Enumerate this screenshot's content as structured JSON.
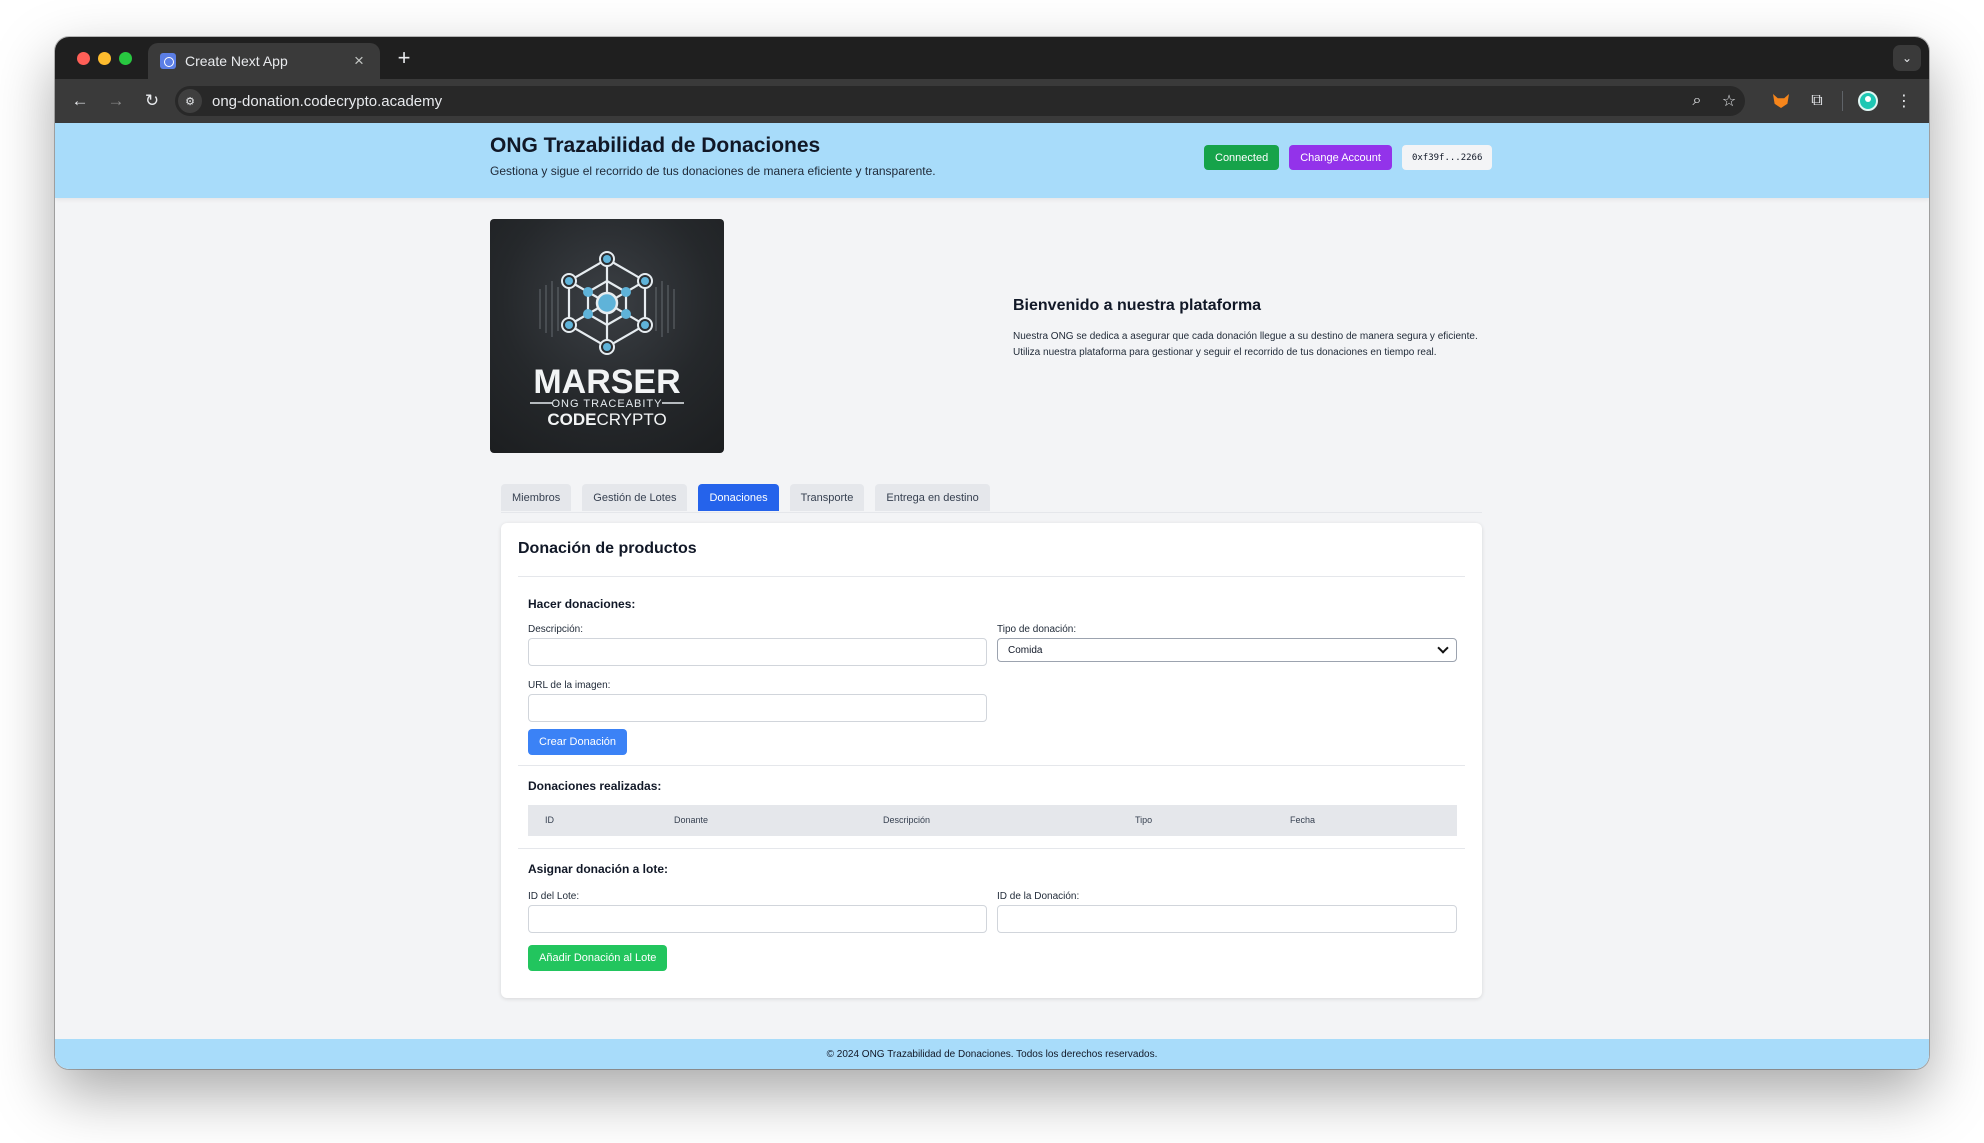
{
  "browser": {
    "tab_title": "Create Next App",
    "url": "ong-donation.codecrypto.academy"
  },
  "header": {
    "title": "ONG Trazabilidad de Donaciones",
    "subtitle": "Gestiona y sigue el recorrido de tus donaciones de manera eficiente y transparente.",
    "connected_label": "Connected",
    "change_account_label": "Change Account",
    "account_address": "0xf39f...2266"
  },
  "logo": {
    "line1": "MARSER",
    "line2": "ONG TRACEABITY",
    "line3_bold": "CODE",
    "line3_light": "CRYPTO"
  },
  "welcome": {
    "title": "Bienvenido a nuestra plataforma",
    "text": "Nuestra ONG se dedica a asegurar que cada donación llegue a su destino de manera segura y eficiente. Utiliza nuestra plataforma para gestionar y seguir el recorrido de tus donaciones en tiempo real."
  },
  "tabs": [
    {
      "label": "Miembros",
      "active": false
    },
    {
      "label": "Gestión de Lotes",
      "active": false
    },
    {
      "label": "Donaciones",
      "active": true
    },
    {
      "label": "Transporte",
      "active": false
    },
    {
      "label": "Entrega en destino",
      "active": false
    }
  ],
  "donation_form": {
    "card_title": "Donación de productos",
    "section_make": "Hacer donaciones:",
    "description_label": "Descripción:",
    "description_value": "",
    "type_label": "Tipo de donación:",
    "type_selected": "Comida",
    "image_url_label": "URL de la imagen:",
    "image_url_value": "",
    "create_button": "Crear Donación"
  },
  "donations_table": {
    "section_title": "Donaciones realizadas:",
    "columns": [
      "ID",
      "Donante",
      "Descripción",
      "Tipo",
      "Fecha"
    ]
  },
  "assign_form": {
    "section_title": "Asignar donación a lote:",
    "lot_id_label": "ID del Lote:",
    "lot_id_value": "",
    "donation_id_label": "ID de la Donación:",
    "donation_id_value": "",
    "add_button": "Añadir Donación al Lote"
  },
  "footer": {
    "text": "© 2024 ONG Trazabilidad de Donaciones. Todos los derechos reservados."
  },
  "colors": {
    "header_bg": "#a8dcfa",
    "connected": "#16a34a",
    "change_account": "#9333ea",
    "active_tab": "#2563eb",
    "create_button": "#3b82f6",
    "add_button": "#22c55e"
  },
  "icons": {
    "back": "arrow-left-icon",
    "forward": "arrow-right-icon",
    "reload": "reload-icon",
    "site_info": "tune-icon",
    "zoom": "magnifier-icon",
    "bookmark": "star-icon",
    "extension_wallet": "metamask-fox-icon",
    "extensions": "puzzle-icon",
    "profile": "avatar-icon",
    "menu": "kebab-menu-icon"
  }
}
